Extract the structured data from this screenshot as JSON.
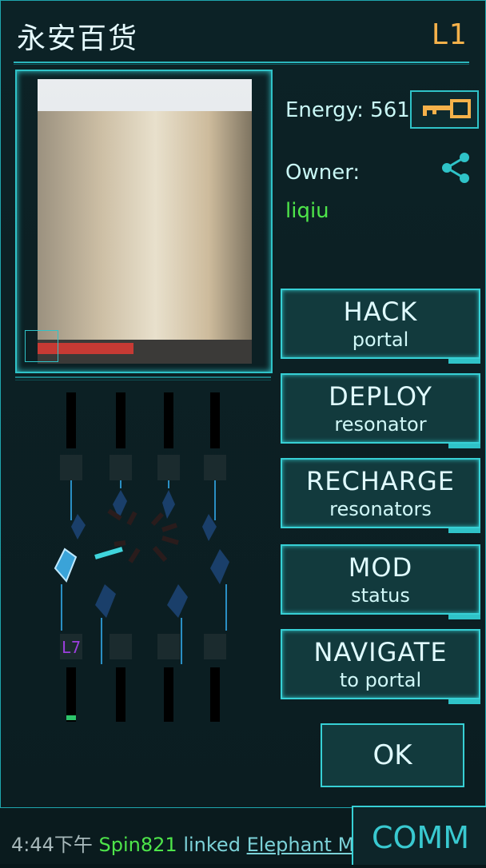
{
  "portal": {
    "title": "永安百货",
    "level": "L1",
    "energy_label": "Energy:",
    "energy_value": "561",
    "owner_label": "Owner:",
    "owner_name": "liqiu"
  },
  "actions": [
    {
      "main": "HACK",
      "sub": "portal"
    },
    {
      "main": "DEPLOY",
      "sub": "resonator"
    },
    {
      "main": "RECHARGE",
      "sub": "resonators"
    },
    {
      "main": "MOD",
      "sub": "status"
    },
    {
      "main": "NAVIGATE",
      "sub": "to portal"
    }
  ],
  "ok_label": "OK",
  "resonator_level_label": "L7",
  "ticker": {
    "time": "4:44下午",
    "agent": "Spin821",
    "action": "linked",
    "portal": "Elephant Ma"
  },
  "comm_label": "COMM",
  "colors": {
    "accent": "#2fc3c8",
    "owner": "#4ee54a",
    "level": "#f5b14a",
    "resonator": "#9d3fe0"
  }
}
